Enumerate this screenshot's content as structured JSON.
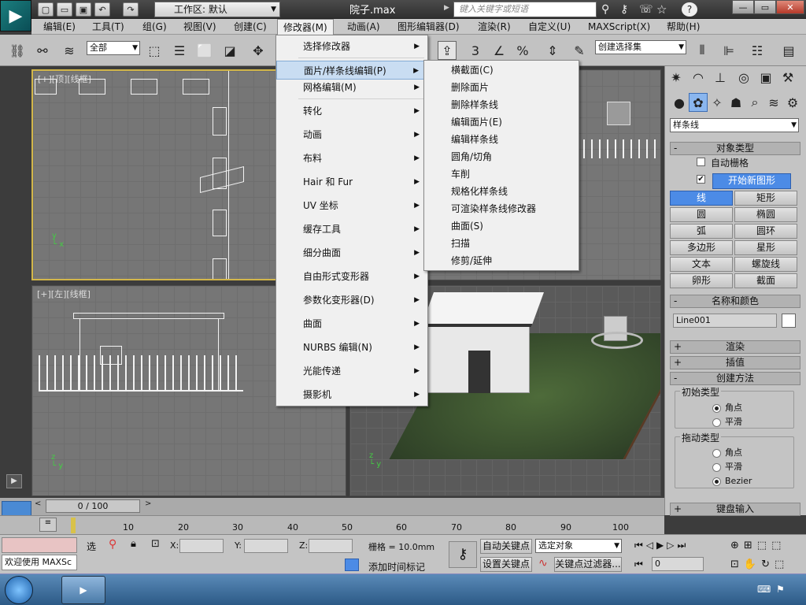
{
  "titlebar": {
    "workspace_label": "工作区: 默认",
    "document_title": "院子.max",
    "search_placeholder": "键入关键字或短语"
  },
  "menubar": {
    "items": [
      "编辑(E)",
      "工具(T)",
      "组(G)",
      "视图(V)",
      "创建(C)",
      "修改器(M)",
      "动画(A)",
      "图形编辑器(D)",
      "渲染(R)",
      "自定义(U)",
      "MAXScript(X)",
      "帮助(H)"
    ]
  },
  "toolbar": {
    "selection_filter": "全部",
    "named_selection": "创建选择集"
  },
  "viewports": {
    "top_label": "[+][顶][线框]",
    "left_label": "[+][左][线框]"
  },
  "modifiers_menu": {
    "items": [
      "选择修改器",
      "面片/样条线编辑(P)",
      "网格编辑(M)",
      "转化",
      "动画",
      "布料",
      "Hair 和 Fur",
      "UV 坐标",
      "缓存工具",
      "细分曲面",
      "自由形式变形器",
      "参数化变形器(D)",
      "曲面",
      "NURBS 编辑(N)",
      "光能传递",
      "摄影机"
    ]
  },
  "submenu": {
    "items": [
      "横截面(C)",
      "删除面片",
      "删除样条线",
      "编辑面片(E)",
      "编辑样条线",
      "圆角/切角",
      "车削",
      "规格化样条线",
      "可渲染样条线修改器",
      "曲面(S)",
      "扫描",
      "修剪/延伸"
    ]
  },
  "command_panel": {
    "category": "样条线",
    "object_type": {
      "title": "对象类型",
      "autogrid": "自动栅格",
      "start_new_shape": "开始新图形",
      "buttons": [
        "线",
        "矩形",
        "圆",
        "椭圆",
        "弧",
        "圆环",
        "多边形",
        "星形",
        "文本",
        "螺旋线",
        "卵形",
        "截面"
      ]
    },
    "name_color": {
      "title": "名称和颜色",
      "name_value": "Line001",
      "color": "#ffffff"
    },
    "rollouts": {
      "render": "渲染",
      "interpolation": "插值",
      "creation_method": "创建方法",
      "keyboard_entry": "键盘输入"
    },
    "initial_type": {
      "title": "初始类型",
      "options": [
        "角点",
        "平滑"
      ],
      "selected": 0
    },
    "drag_type": {
      "title": "拖动类型",
      "options": [
        "角点",
        "平滑",
        "Bezier"
      ],
      "selected": 2
    }
  },
  "timeline": {
    "frame_display": "0 / 100",
    "ticks": [
      "10",
      "20",
      "30",
      "40",
      "50",
      "60",
      "70",
      "80",
      "90",
      "100"
    ]
  },
  "status": {
    "welcome": "欢迎使用 MAXSc",
    "select_label": "选",
    "x_label": "X:",
    "y_label": "Y:",
    "z_label": "Z:",
    "grid_text": "栅格 = 10.0mm",
    "autokey": "自动关键点",
    "setkey": "设置关键点",
    "selected_object": "选定对象",
    "key_filter": "关键点过滤器...",
    "add_time_tag": "添加时间标记",
    "frame_value": "0"
  },
  "colors": {
    "accent": "#4c8be6",
    "top_viewport_border": "#d2b64a",
    "menu_highlight": "#c9ddf2"
  }
}
